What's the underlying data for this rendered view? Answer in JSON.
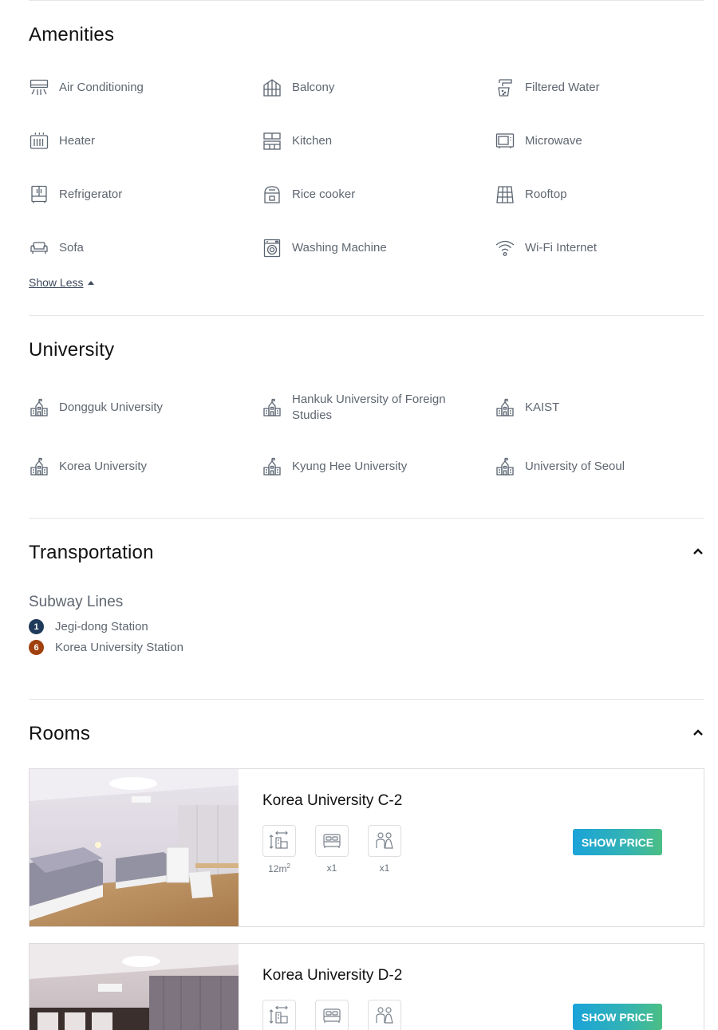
{
  "amenities": {
    "title": "Amenities",
    "items": [
      {
        "label": "Air Conditioning",
        "icon": "air-conditioner-icon"
      },
      {
        "label": "Balcony",
        "icon": "balcony-icon"
      },
      {
        "label": "Filtered Water",
        "icon": "water-filter-icon"
      },
      {
        "label": "Heater",
        "icon": "heater-icon"
      },
      {
        "label": "Kitchen",
        "icon": "kitchen-icon"
      },
      {
        "label": "Microwave",
        "icon": "microwave-icon"
      },
      {
        "label": "Refrigerator",
        "icon": "refrigerator-icon"
      },
      {
        "label": "Rice cooker",
        "icon": "rice-cooker-icon"
      },
      {
        "label": "Rooftop",
        "icon": "rooftop-icon"
      },
      {
        "label": "Sofa",
        "icon": "sofa-icon"
      },
      {
        "label": "Washing Machine",
        "icon": "washing-machine-icon"
      },
      {
        "label": "Wi-Fi Internet",
        "icon": "wifi-icon"
      }
    ],
    "show_less_label": "Show Less"
  },
  "university": {
    "title": "University",
    "icon": "school-building-icon",
    "items": [
      {
        "label": "Dongguk University"
      },
      {
        "label": "Hankuk University of Foreign Studies"
      },
      {
        "label": "KAIST"
      },
      {
        "label": "Korea University"
      },
      {
        "label": "Kyung Hee University"
      },
      {
        "label": "University of Seoul"
      }
    ]
  },
  "transportation": {
    "title": "Transportation",
    "subway_heading": "Subway Lines",
    "stations": [
      {
        "line": "1",
        "name": "Jegi-dong Station",
        "color": "#1f3a5a"
      },
      {
        "line": "6",
        "name": "Korea University Station",
        "color": "#a0400c"
      }
    ]
  },
  "rooms": {
    "title": "Rooms",
    "button_label": "SHOW PRICE",
    "items": [
      {
        "name": "Korea University C-2",
        "area": "12m",
        "area_sup": "2",
        "beds": "x1",
        "occupants": "x1"
      },
      {
        "name": "Korea University D-2",
        "area": "",
        "area_sup": "",
        "beds": "",
        "occupants": ""
      }
    ]
  },
  "colors": {
    "text_primary": "#111111",
    "text_secondary": "#5f6670",
    "divider": "#e6e6e6",
    "button_gradient_start": "#1aa3d9",
    "button_gradient_end": "#4bbf84"
  }
}
